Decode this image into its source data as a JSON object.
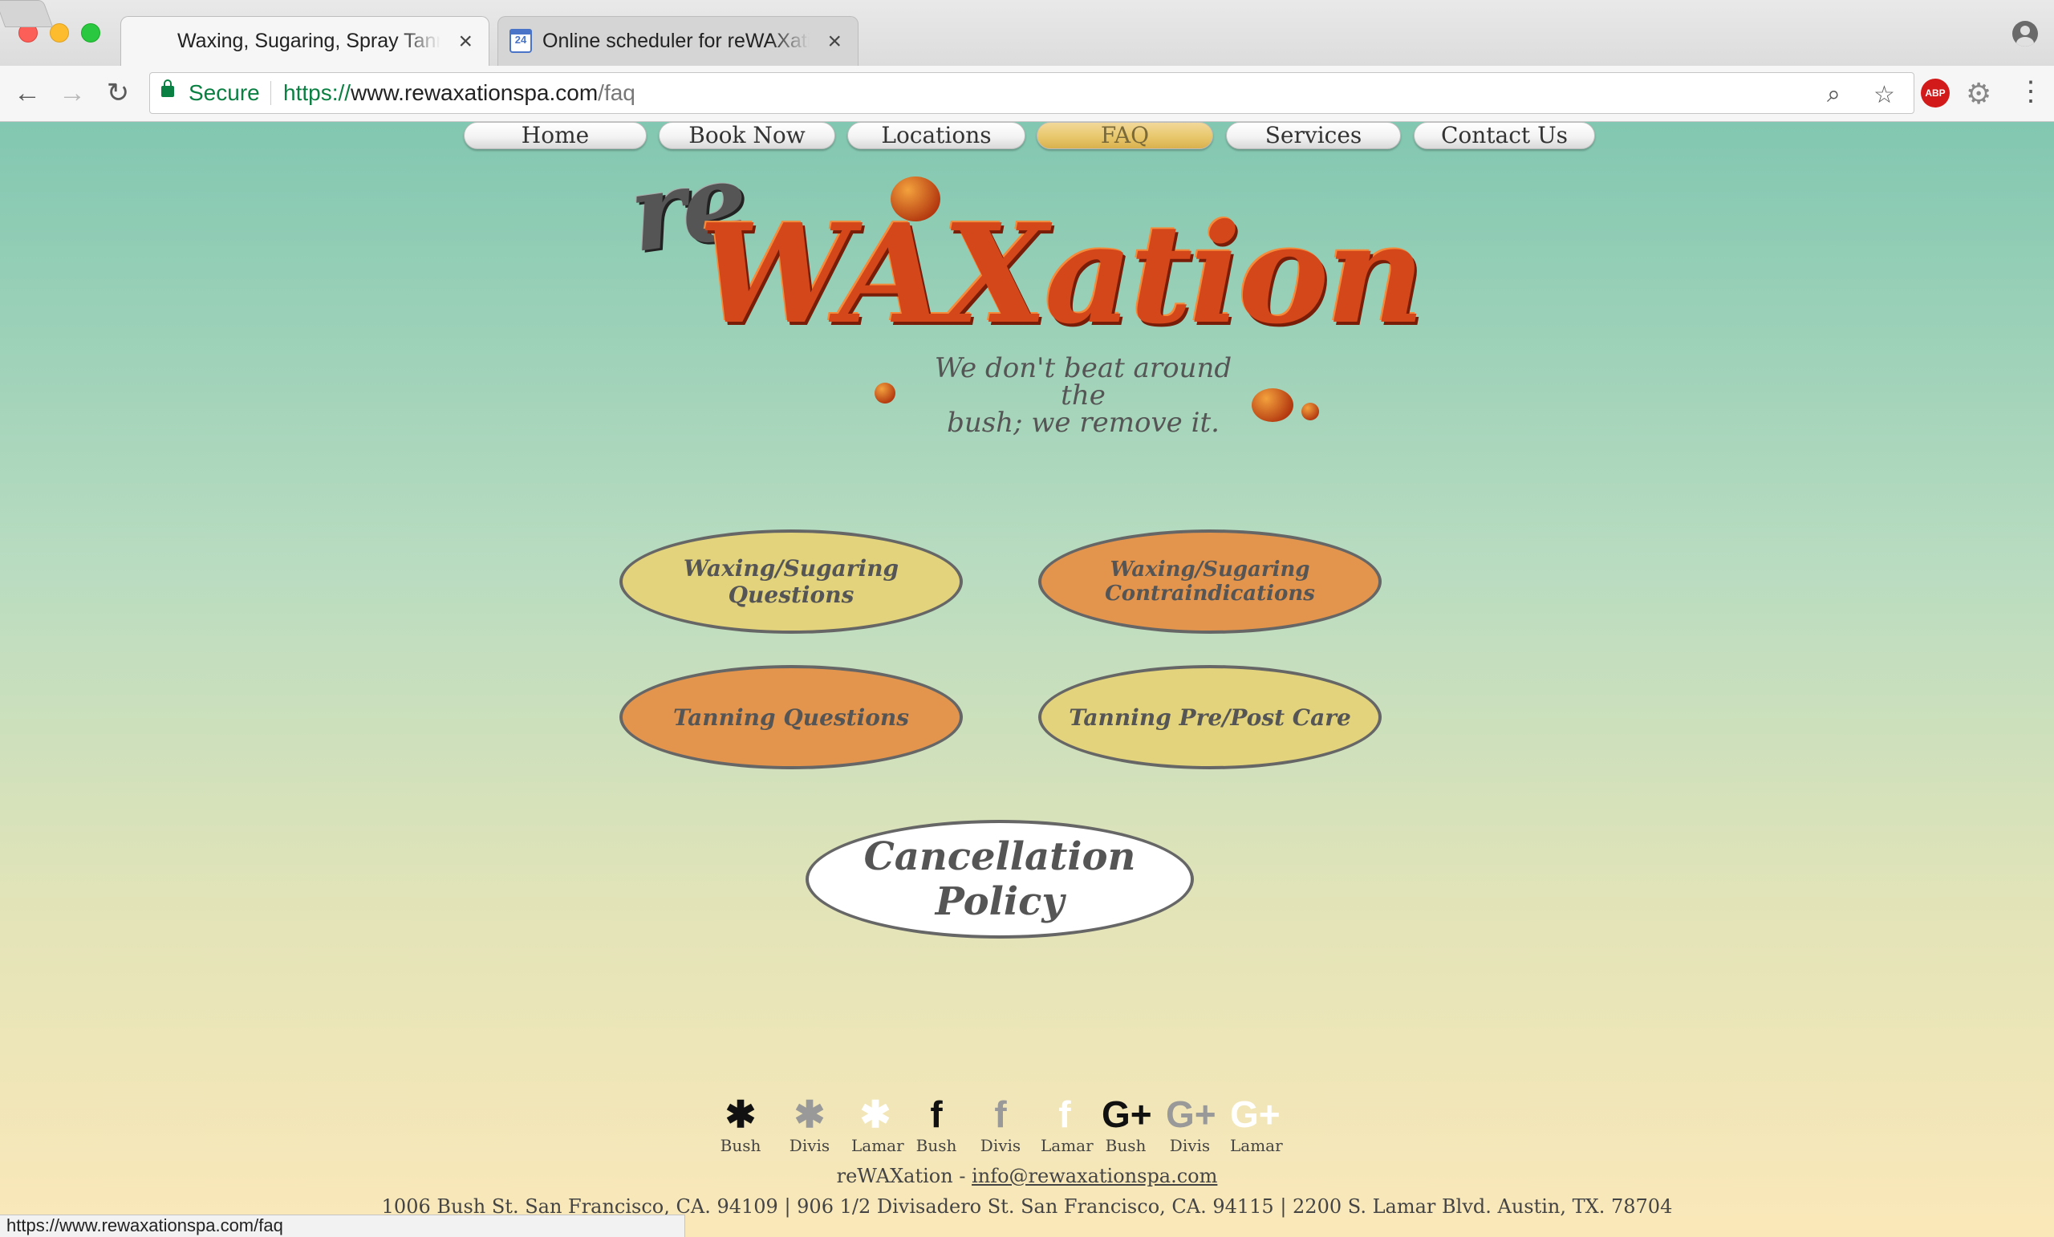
{
  "browser": {
    "tabs": [
      {
        "title": "Waxing, Sugaring, Spray Tanning",
        "close": "×"
      },
      {
        "title": "Online scheduler for reWAXation",
        "close": "×",
        "icon_text": "24"
      }
    ],
    "nav": {
      "back": "←",
      "forward": "→",
      "reload": "↻"
    },
    "address": {
      "secure_label": "Secure",
      "scheme": "https://",
      "host": "www.rewaxationspa.com",
      "path": "/faq"
    },
    "icons": {
      "zoom": "⌕",
      "star": "☆",
      "abp": "ABP",
      "gear": "⚙",
      "menu": "⋮"
    },
    "status_url": "https://www.rewaxationspa.com/faq"
  },
  "site": {
    "logo": {
      "re": "re",
      "wax": "WAXation",
      "tagline_line1": "We don't beat around the",
      "tagline_line2": "bush; we remove it."
    },
    "nav": [
      "Home",
      "Book Now",
      "Locations",
      "FAQ",
      "Services",
      "Contact Us"
    ],
    "active_nav": "FAQ",
    "faq_buttons": {
      "waxing_questions": "Waxing/Sugaring Questions",
      "contraindications": "Waxing/Sugaring Contraindications",
      "tanning_questions": "Tanning Questions",
      "tanning_care": "Tanning Pre/Post Care",
      "cancellation": "Cancellation Policy"
    },
    "social": [
      {
        "icon": "yelp-icon",
        "glyph": "✱",
        "label": "Bush",
        "tone": "black"
      },
      {
        "icon": "yelp-icon",
        "glyph": "✱",
        "label": "Divis",
        "tone": "gray"
      },
      {
        "icon": "yelp-icon",
        "glyph": "✱",
        "label": "Lamar",
        "tone": "white"
      },
      {
        "icon": "facebook-icon",
        "glyph": "f",
        "label": "Bush",
        "tone": "black"
      },
      {
        "icon": "facebook-icon",
        "glyph": "f",
        "label": "Divis",
        "tone": "gray"
      },
      {
        "icon": "facebook-icon",
        "glyph": "f",
        "label": "Lamar",
        "tone": "white"
      },
      {
        "icon": "google-plus-icon",
        "glyph": "G+",
        "label": "Bush",
        "tone": "black"
      },
      {
        "icon": "google-plus-icon",
        "glyph": "G+",
        "label": "Divis",
        "tone": "gray"
      },
      {
        "icon": "google-plus-icon",
        "glyph": "G+",
        "label": "Lamar",
        "tone": "white"
      }
    ],
    "footer": {
      "name": "reWAXation - ",
      "email": "info@rewaxationspa.com",
      "addresses": "1006 Bush St. San Francisco, CA. 94109 | 906 1/2 Divisadero St. San Francisco, CA. 94115 | 2200 S. Lamar Blvd. Austin, TX. 78704"
    }
  },
  "colors": {
    "bg_top": "#82c7b1",
    "bg_bottom": "#fbe8b9",
    "oval_yellow": "#e2d37c",
    "oval_orange": "#e3954e",
    "nav_active": "#e8c86c"
  }
}
